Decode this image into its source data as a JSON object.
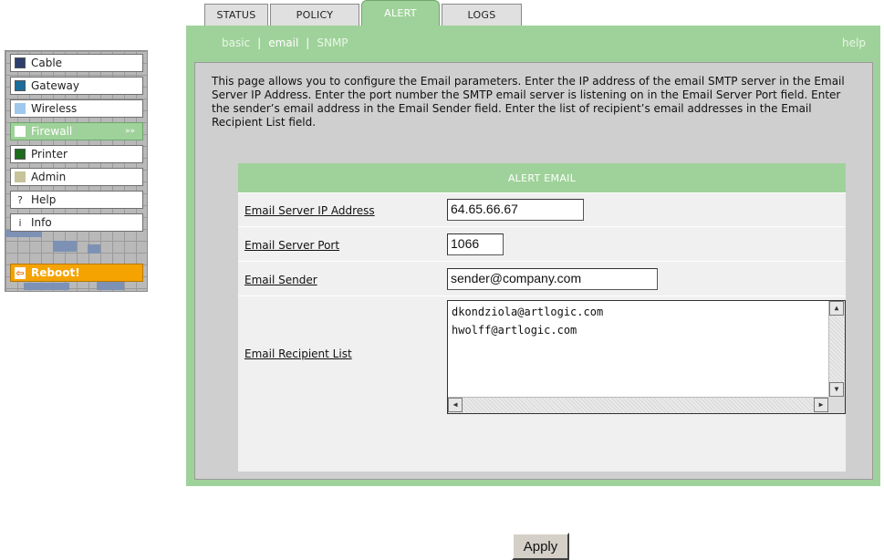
{
  "sidebar": {
    "items": [
      {
        "label": "Cable",
        "color": "#2e3f6e"
      },
      {
        "label": "Gateway",
        "color": "#1a6c9c"
      },
      {
        "label": "Wireless",
        "color": "#9ec8ec"
      },
      {
        "label": "Firewall",
        "color": "#ffffff",
        "arrows": "»»"
      },
      {
        "label": "Printer",
        "color": "#1e6b1e"
      },
      {
        "label": "Admin",
        "color": "#c7c39a"
      },
      {
        "label": "Help",
        "glyph": "?"
      },
      {
        "label": "Info",
        "glyph": "i"
      }
    ],
    "reboot": {
      "label": "Reboot!",
      "glyph": "⇦"
    }
  },
  "tabs": [
    "STATUS",
    "POLICY",
    "ALERT",
    "LOGS"
  ],
  "active_tab": "ALERT",
  "subnav": {
    "items": [
      "basic",
      "email",
      "SNMP"
    ],
    "current": "email",
    "help": "help"
  },
  "intro": "This page allows you to configure the Email parameters. Enter the IP address of the email SMTP server in the Email Server IP Address. Enter the port number the SMTP email server is listening on in the Email Server Port field. Enter the sender’s email address in the Email Sender field. Enter the list of recipient’s email addresses in the Email Recipient List field.",
  "form": {
    "title": "ALERT EMAIL",
    "server_ip_label": "Email Server IP Address",
    "server_ip_value": "64.65.66.67",
    "server_port_label": "Email Server Port",
    "server_port_value": "1066",
    "sender_label": "Email Sender",
    "sender_value": "sender@company.com",
    "recipients_label": "Email Recipient List",
    "recipients": [
      "dkondziola@artlogic.com",
      "hwolff@artlogic.com"
    ],
    "apply_label": "Apply"
  },
  "colors": {
    "accent_green": "#9fd29a",
    "reboot_orange": "#f5a300",
    "content_gray": "#cfcfcf"
  }
}
